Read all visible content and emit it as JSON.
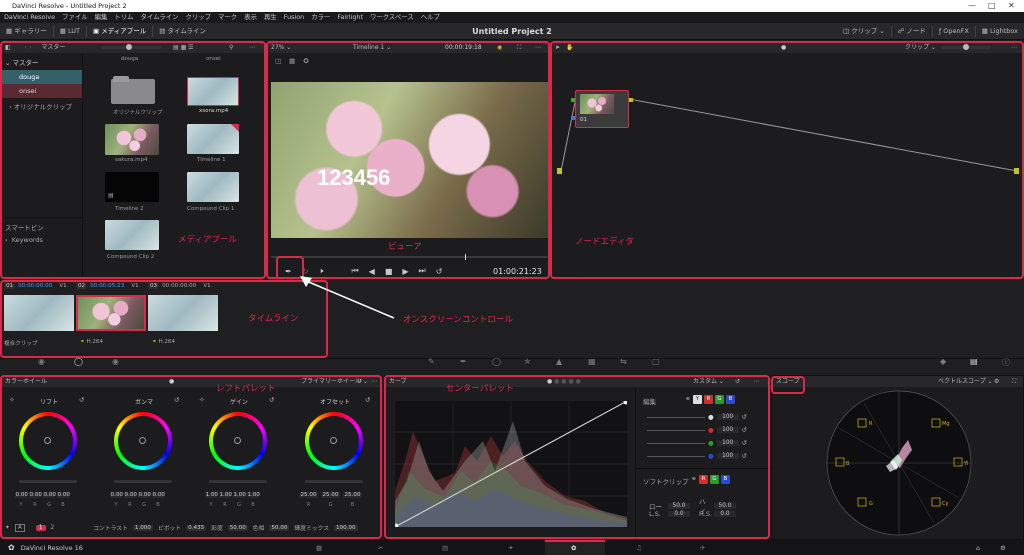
{
  "window": {
    "title": "DaVinci Resolve - Untitled Project 2"
  },
  "menu": [
    "DaVinci Resolve",
    "ファイル",
    "編集",
    "トリム",
    "タイムライン",
    "クリップ",
    "マーク",
    "表示",
    "再生",
    "Fusion",
    "カラー",
    "Fairlight",
    "ワークスペース",
    "ヘルプ"
  ],
  "pagebar": {
    "left": [
      "ギャラリー",
      "LUT",
      "メディアプール",
      "タイムライン"
    ],
    "project_title": "Untitled Project 2",
    "right": [
      "クリップ",
      "ノード",
      "OpenFX",
      "Lightbox"
    ]
  },
  "mediapool": {
    "header_label": "マスター",
    "tree": [
      "マスター",
      "douga",
      "onsei",
      "オリジナルクリップ"
    ],
    "column_labels": [
      "douga",
      "onsei"
    ],
    "items": [
      "オリジナルクリップ",
      "xsora.mp4",
      "sakura.mp4",
      "Timeline 1",
      "Timeline 2",
      "Compound Clip 1",
      "Compound Clip 2"
    ],
    "smartbin": "スマートビン",
    "keywords": "Keywords"
  },
  "viewer": {
    "zoom": "27%",
    "timeline_name": "Timeline 1",
    "timecode_top": "00:00:19:18",
    "overlay_text": "123456",
    "timecode": "01:00:21:23"
  },
  "node_editor": {
    "mode": "クリップ",
    "node_label": "01"
  },
  "timeline_clips": [
    {
      "index": "01",
      "tc": "00:00:00:00",
      "track": "V1",
      "caption": "複合クリップ"
    },
    {
      "index": "02",
      "tc": "00:00:05:23",
      "track": "V1",
      "caption": "H.264"
    },
    {
      "index": "03",
      "tc": "00:00:00:00",
      "track": "V1",
      "caption": "H.264"
    }
  ],
  "color_wheels": {
    "header": "カラーホイール",
    "mode": "プライマリーホイール",
    "wheels": [
      {
        "name": "リフト",
        "values": [
          "0.00",
          "0.00",
          "0.00",
          "0.00"
        ]
      },
      {
        "name": "ガンマ",
        "values": [
          "0.00",
          "0.00",
          "0.00",
          "0.00"
        ]
      },
      {
        "name": "ゲイン",
        "values": [
          "1.00",
          "1.00",
          "1.00",
          "1.00"
        ]
      },
      {
        "name": "オフセット",
        "values": [
          "25.00",
          "25.00",
          "25.00"
        ]
      }
    ],
    "channel_labels": [
      "Y",
      "R",
      "G",
      "B"
    ],
    "page_a": "1",
    "page_b": "2",
    "params": [
      {
        "label": "コントラスト",
        "value": "1.000"
      },
      {
        "label": "ピボット",
        "value": "0.435"
      },
      {
        "label": "彩度",
        "value": "50.00"
      },
      {
        "label": "色相",
        "value": "50.00"
      },
      {
        "label": "輝度ミックス",
        "value": "100.00"
      }
    ]
  },
  "curves": {
    "header": "カーブ",
    "mode": "カスタム",
    "edit_label": "編集",
    "channels": [
      "Y",
      "R",
      "G",
      "B"
    ],
    "values": [
      "100",
      "100",
      "100",
      "100"
    ],
    "soft_clip": "ソフトクリップ",
    "soft_fields": [
      {
        "label": "ロー",
        "value": "50.0"
      },
      {
        "label": "ハイ",
        "value": "50.0"
      },
      {
        "label": "L.S.",
        "value": "0.0"
      },
      {
        "label": "H.S.",
        "value": "0.0"
      }
    ]
  },
  "scope": {
    "header": "スコープ",
    "mode": "ベクトルスコープ",
    "targets": [
      "R",
      "Mg",
      "B",
      "Cy",
      "G",
      "Yl"
    ]
  },
  "bottom": {
    "app_name": "DaVinci Resolve 16"
  },
  "annotations": {
    "media_pool": "メディアプール",
    "viewer": "ビューア",
    "node_editor": "ノードエディタ",
    "timeline": "タイムライン",
    "onscreen": "オンスクリーンコントロール",
    "left_palette": "レフトパレット",
    "center_palette": "センターパレット"
  },
  "colors": {
    "annotation": "#e8264b",
    "accent": "#3aa0ff",
    "bg": "#1c1c1f"
  }
}
